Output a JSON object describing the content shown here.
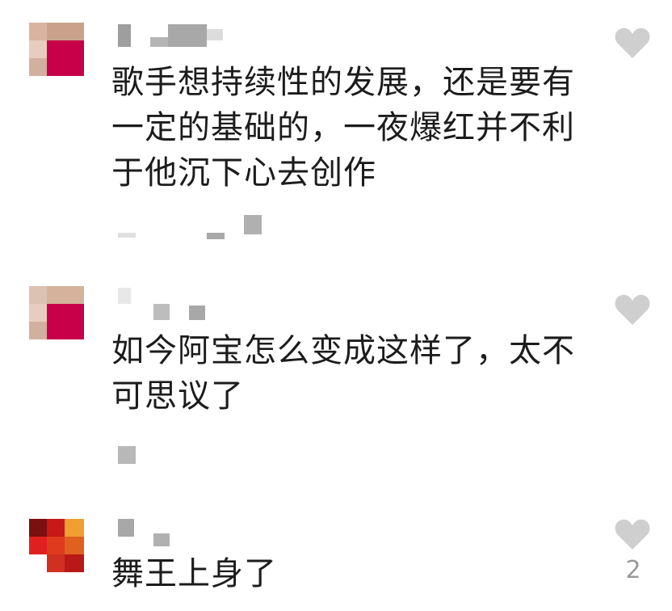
{
  "comments": [
    {
      "text": "歌手想持续性的发展，还是要有一定的基础的，一夜爆红并不利于他沉下心去创作",
      "avatar_colors": [
        "#d9b3a0",
        "#c8004a",
        "#e8c8b8"
      ],
      "liked": false
    },
    {
      "text": "如今阿宝怎么变成这样了，太不可思议了",
      "avatar_colors": [
        "#d4b29c",
        "#c8004a",
        "#e9cbb9"
      ],
      "liked": false
    },
    {
      "text": "舞王上身了",
      "avatar_colors": [
        "#7a1010",
        "#e02020",
        "#f0a030"
      ],
      "liked": false,
      "like_count": "2"
    }
  ],
  "colors": {
    "heart": "#cfcfcf",
    "like_count": "#9a9a9a",
    "redacted": "#bdbdbd"
  },
  "icons": {
    "like": "heart-outline-icon"
  }
}
